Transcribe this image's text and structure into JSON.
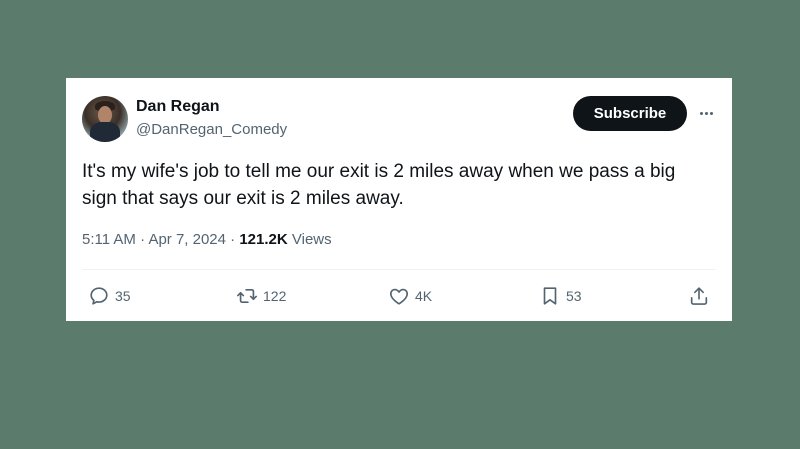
{
  "author": {
    "name": "Dan Regan",
    "handle": "@DanRegan_Comedy"
  },
  "subscribe_label": "Subscribe",
  "tweet": {
    "line1": "It's my wife's job to tell me our exit is 2 miles away when we pass a big",
    "line2": "sign that says our exit is 2 miles away."
  },
  "meta": {
    "time": "5:11 AM",
    "sep1": " · ",
    "date": "Apr 7, 2024",
    "sep2": " · ",
    "views_count": "121.2K",
    "views_label": "Views"
  },
  "actions": {
    "replies": "35",
    "retweets": "122",
    "likes": "4K",
    "bookmarks": "53"
  }
}
